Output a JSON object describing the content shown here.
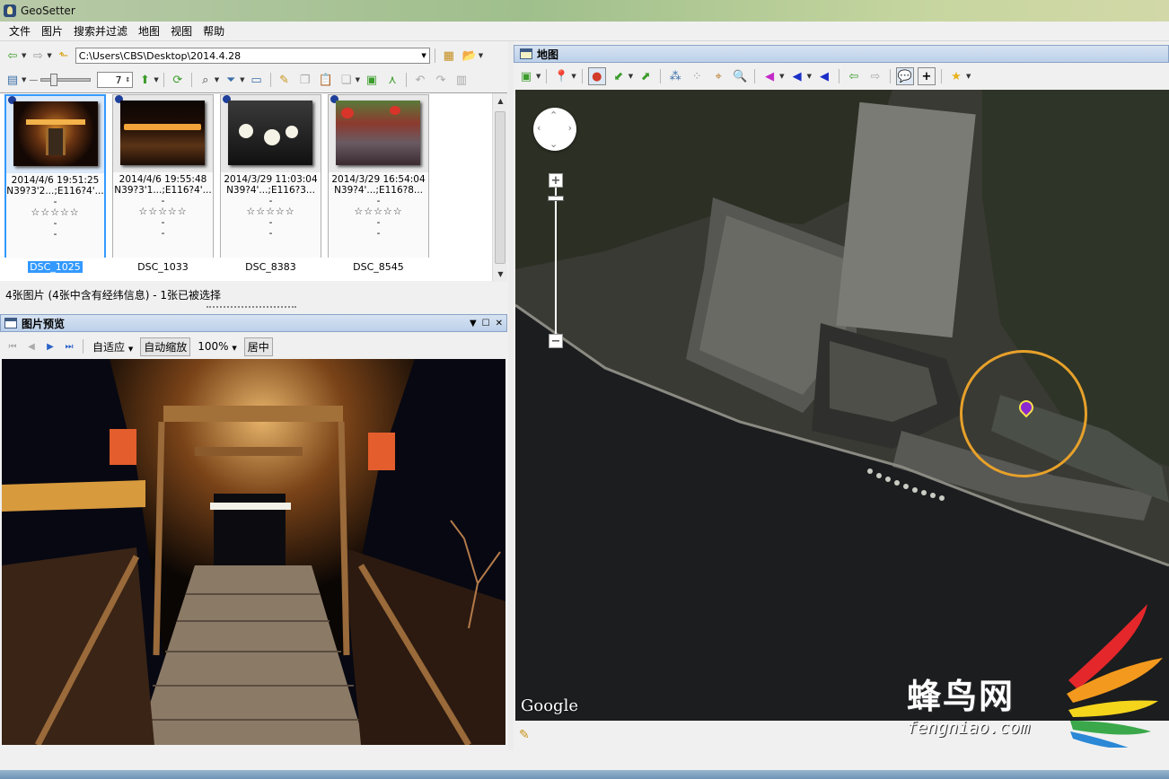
{
  "window": {
    "title": "GeoSetter"
  },
  "menu": [
    "文件",
    "图片",
    "搜索并过滤",
    "地图",
    "视图",
    "帮助"
  ],
  "path_bar": {
    "path": "C:\\Users\\CBS\\Desktop\\2014.4.28"
  },
  "thumb_toolbar": {
    "size_value": "7"
  },
  "thumbnails": [
    {
      "date": "2014/4/6 19:51:25",
      "coords": "N39?3'2...;E116?4'...",
      "line3": "-",
      "stars": "☆☆☆☆☆",
      "line5": "-",
      "line6": "-",
      "name": "DSC_1025",
      "selected": true
    },
    {
      "date": "2014/4/6 19:55:48",
      "coords": "N39?3'1...;E116?4'...",
      "line3": "-",
      "stars": "☆☆☆☆☆",
      "line5": "-",
      "line6": "-",
      "name": "DSC_1033",
      "selected": false
    },
    {
      "date": "2014/3/29 11:03:04",
      "coords": "N39?4'...;E116?3...",
      "line3": "-",
      "stars": "☆☆☆☆☆",
      "line5": "-",
      "line6": "-",
      "name": "DSC_8383",
      "selected": false
    },
    {
      "date": "2014/3/29 16:54:04",
      "coords": "N39?4'...;E116?8...",
      "line3": "-",
      "stars": "☆☆☆☆☆",
      "line5": "-",
      "line6": "-",
      "name": "DSC_8545",
      "selected": false
    }
  ],
  "status": {
    "text": "4张图片 (4张中含有经纬信息) - 1张已被选择"
  },
  "preview": {
    "title": "图片预览",
    "fit_label": "自适应",
    "auto_zoom_label": "自动缩放",
    "zoom_value": "100%",
    "center_label": "居中"
  },
  "map": {
    "title": "地图",
    "google_label": "Google",
    "watermark_cn": "蜂鸟网",
    "watermark_en": "fengniao.com"
  },
  "colors": {
    "selection": "#3399ff",
    "panel_header": "#bcd0ea",
    "target_circle": "#e7a12a",
    "marker": "#8b2ad0"
  }
}
